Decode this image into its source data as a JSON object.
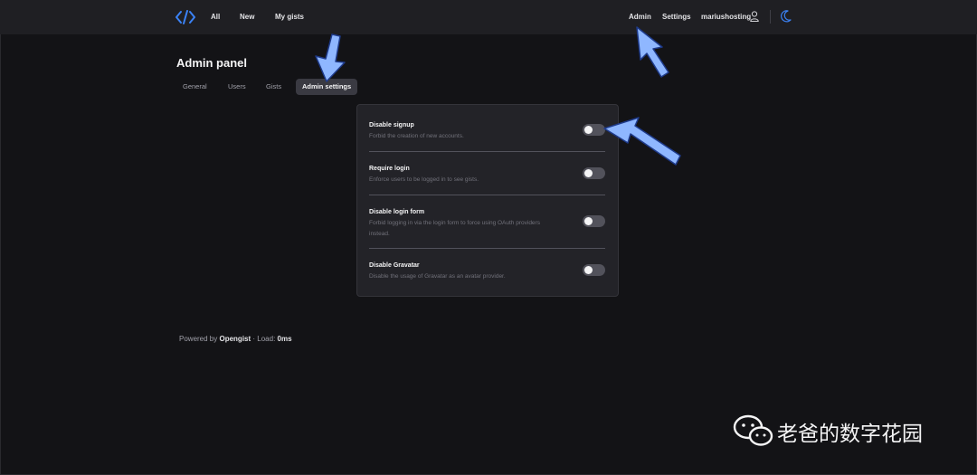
{
  "header": {
    "nav": [
      "All",
      "New",
      "My gists"
    ],
    "right": [
      "Admin",
      "Settings",
      "mariushosting"
    ]
  },
  "page": {
    "title": "Admin panel",
    "tabs": [
      "General",
      "Users",
      "Gists",
      "Admin settings"
    ],
    "active_tab": "Admin settings"
  },
  "settings": [
    {
      "title": "Disable signup",
      "desc": "Forbid the creation of new accounts.",
      "enabled": false
    },
    {
      "title": "Require login",
      "desc": "Enforce users to be logged in to see gists.",
      "enabled": false
    },
    {
      "title": "Disable login form",
      "desc": "Forbid logging in via the login form to force using OAuth providers instead.",
      "enabled": false
    },
    {
      "title": "Disable Gravatar",
      "desc": "Disable the usage of Gravatar as an avatar provider.",
      "enabled": false
    }
  ],
  "footer": {
    "powered": "Powered by",
    "brand": "Opengist",
    "load_label": "· Load:",
    "load_value": "0ms"
  },
  "watermark": {
    "text": "老爸的数字花园"
  },
  "colors": {
    "accent": "#3b82f6",
    "arrow": "#8fb7ff",
    "background": "#131316",
    "panel": "#232328"
  }
}
